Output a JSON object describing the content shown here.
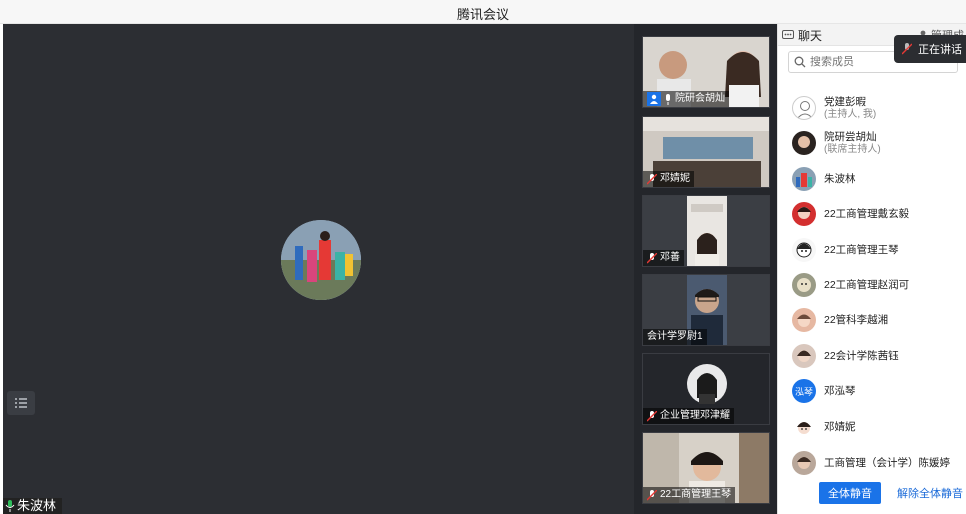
{
  "window": {
    "title": "腾讯会议"
  },
  "main": {
    "speaker_name": "朱波林"
  },
  "thumbnails": [
    {
      "label": "院研会胡灿",
      "muted": false
    },
    {
      "label": "邓婧妮",
      "muted": true
    },
    {
      "label": "邓善",
      "muted": true
    },
    {
      "label": "会计学罗尉1",
      "muted": false
    },
    {
      "label": "企业管理邓津耀",
      "muted": true
    },
    {
      "label": "22工商管理王琴",
      "muted": true
    }
  ],
  "panel": {
    "tab_chat": "聊天",
    "tab_manage": "管理成",
    "speaking_tip": "正在讲话",
    "search_placeholder": "搜索成员",
    "members": [
      {
        "name": "党建彭暇",
        "role": "(主持人, 我)"
      },
      {
        "name": "院研尝胡灿",
        "role": "(联席主持人)"
      },
      {
        "name": "朱波林",
        "role": ""
      },
      {
        "name": "22工商管理戴玄毅",
        "role": ""
      },
      {
        "name": "22工商管理王琴",
        "role": ""
      },
      {
        "name": "22工商管理赵润可",
        "role": ""
      },
      {
        "name": "22管科李越湘",
        "role": ""
      },
      {
        "name": "22会计学陈茜钰",
        "role": ""
      },
      {
        "name": "邓泓琴",
        "role": "",
        "initials": "泓琴"
      },
      {
        "name": "邓婧妮",
        "role": ""
      },
      {
        "name": "工商管理（会计学）陈媛婷",
        "role": ""
      }
    ],
    "mute_all": "全体静音",
    "unmute_all": "解除全体静音"
  },
  "colors": {
    "accent": "#1a73e8",
    "video_bg": "#2c2e33",
    "mic_active": "#2fbf5b"
  }
}
